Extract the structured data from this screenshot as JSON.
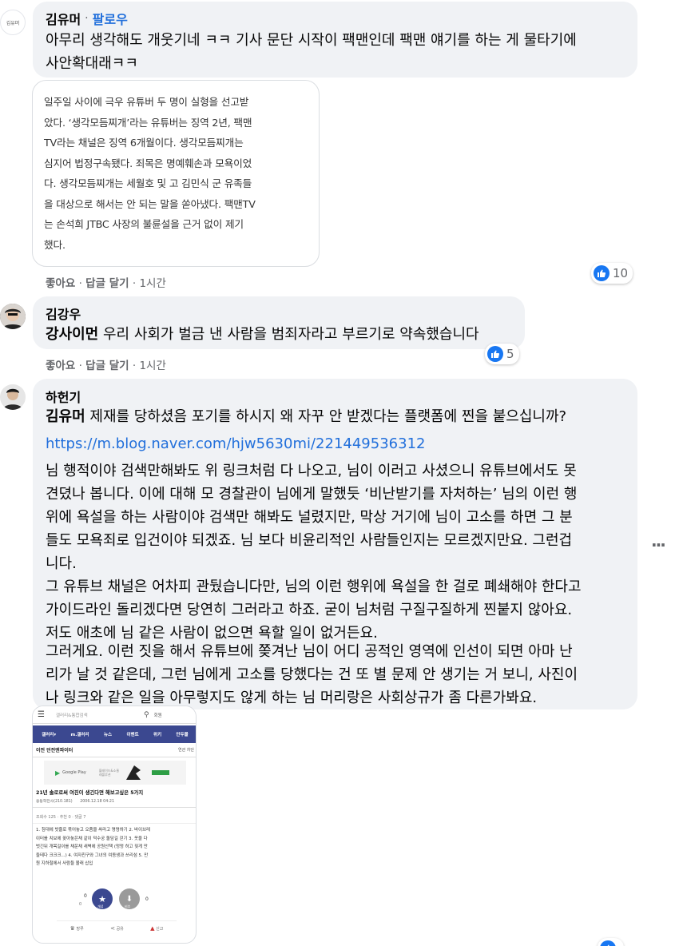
{
  "comment1": {
    "avatar_text": "김유머",
    "author": "김유머",
    "follow_label": "팔로우",
    "text_line1": "아무리 생각해도 개웃기네 ㅋㅋ 기사 문단 시작이 팩맨인데 팩맨 얘기를 하는 게 물타기에",
    "text_line2": "사안확대래ㅋㅋ",
    "quote_lines": [
      "일주일 사이에 극우 유튜버 두 명이 실형을 선고받",
      "았다. ‘생각모듬찌개’라는 유튜버는 징역 2년, 팩맨",
      "TV라는 채널은 징역 6개월이다. 생각모듬찌개는",
      "심지어 법정구속됐다. 죄목은 명예훼손과 모욕이었",
      "다. 생각모듬찌개는 세월호 및 고 김민식 군 유족들",
      "을 대상으로 해서는 안 되는 말을 쏟아냈다. 팩맨TV",
      "는 손석희 JTBC 사장의 불륜설을 근거 없이 제기",
      "했다."
    ],
    "like_label": "좋아요",
    "reply_label": "답글 달기",
    "time": "1시간",
    "reaction_count": "10"
  },
  "comment2": {
    "author": "김강우",
    "mention": "강사이먼",
    "text": " 우리 사회가 벌금 낸 사람을 범죄자라고 부르기로 약속했습니다",
    "like_label": "좋아요",
    "reply_label": "답글 달기",
    "time": "1시간",
    "reaction_count": "5"
  },
  "comment3": {
    "author": "하헌기",
    "mention": "김유머",
    "first_line": " 제재를 당하셨음 포기를 하시지 왜 자꾸 안 받겠다는 플랫폼에 찐을 붙으십니까?",
    "link": "https://m.blog.naver.com/hjw5630mi/221449536312",
    "para1_lines": [
      "님 행적이야 검색만해봐도 위 링크처럼 다 나오고, 님이 이러고 사셨으니 유튜브에서도 못",
      "견뎠나 봅니다. 이에 대해 모 경찰관이 님에게 말했듯 ‘비난받기를 자처하는’ 님의 이런 행",
      "위에 욕설을 하는 사람이야 검색만 해봐도 널렸지만, 막상 거기에 님이 고소를 하면 그 분",
      "들도 모욕죄로 입건이야 되겠죠. 님 보다 비윤리적인 사람들인지는 모르겠지만요. 그런겁",
      "니다.",
      "그 유튜브 채널은 어차피 관뒀습니다만, 님의 이런 행위에 욕설을 한 걸로 폐쇄해야 한다고",
      "가이드라인 돌리겠다면 당연히 그러라고 하죠. 굳이 님처럼 구질구질하게 찐붙지 않아요.",
      "저도 애초에 님 같은 사람이 없으면 욕할 일이 없거든요."
    ],
    "para2_lines": [
      "그러게요. 이런 짓을 해서 유튜브에 쫒겨난 님이 어디 공적인 영역에 인선이 되면 아마 난",
      "리가 날 것 같은데, 그런 님에게 고소를 당했다는 건 또 별 문제 안 생기는 거 보니, 사진이",
      "나 링크와 같은 일을 아무렇지도 않게 하는 님 머리랑은 사회상규가 좀 다른가봐요."
    ],
    "more_label": "···"
  },
  "screenshot": {
    "search_placeholder": "갤러리&통합검색",
    "search_extra": "회원",
    "nav_items": [
      "갤러리▾",
      "m.갤러리",
      "뉴스",
      "이벤트",
      "위키",
      "만두몰"
    ],
    "gallery_name": "이전 던전앤파이터",
    "gallery_actions": "연관  차단",
    "store_label": "Google Play",
    "store_promo": "블레이드&소울 레볼루션",
    "post_title": "21년 솔로로써 여친이 생긴다면 해보고싶은 5가지",
    "post_author": "용동학전사(210.181)",
    "post_date": "2006.12.18 04:21",
    "post_stats": "조회수 125 · 추천 0 · 댓글 7",
    "post_body_lines": [
      "1. 침대에 밧줄로 묶어놓고 오줌을 싸라고 명령하기 2. 바이브레",
      "이터를 치보에 꽂아놓은채 같이 덕수궁 돌담길 걷기 3. 옷을 다",
      "벗긴뒤 개목걸이를 채운채 새벽에 공원산책 (멍멍 하고 짖게 만",
      "들테다 크크크...) 4. 여자친구와 그녀의 여동생과 쓰리섬 5. 만",
      "원 지하철에서 사람들 몰래 삽입"
    ],
    "vote_up": "0",
    "vote_down": "0",
    "vote_small": "0",
    "up_label": "개념",
    "down_label": "비추",
    "footer_items": [
      "방루",
      "공유",
      "신고"
    ]
  },
  "bottom_reaction_count": ""
}
